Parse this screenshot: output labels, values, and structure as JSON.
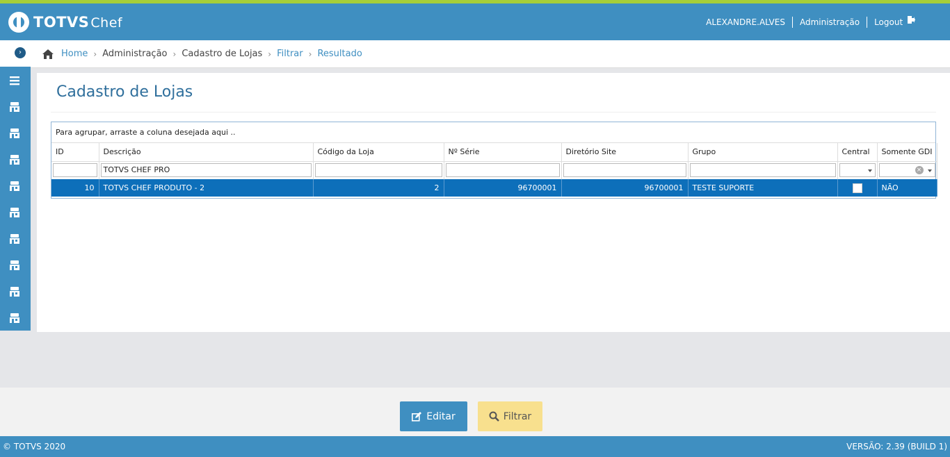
{
  "app": {
    "brand": "TOTVS",
    "brand_sub": "Chef"
  },
  "header": {
    "user": "ALEXANDRE.ALVES",
    "admin_link": "Administração",
    "logout": "Logout"
  },
  "breadcrumb": {
    "home": "Home",
    "items": [
      "Administração",
      "Cadastro de Lojas",
      "Filtrar",
      "Resultado"
    ]
  },
  "page": {
    "title": "Cadastro de Lojas"
  },
  "grid": {
    "group_hint": "Para agrupar, arraste a coluna desejada aqui ..",
    "columns": [
      "ID",
      "Descrição",
      "Código da Loja",
      "Nº Série",
      "Diretório Site",
      "Grupo",
      "Central",
      "Somente GDI"
    ],
    "filters": {
      "descricao": "TOTVS CHEF PRO"
    },
    "rows": [
      {
        "id": "10",
        "descricao": "TOTVS CHEF PRODUTO - 2",
        "codigo": "2",
        "serie": "96700001",
        "diretorio": "96700001",
        "grupo": "TESTE SUPORTE",
        "central": false,
        "somente_gdi": "NÃO"
      }
    ]
  },
  "buttons": {
    "edit": "Editar",
    "filter": "Filtrar"
  },
  "status": {
    "copyright": "© TOTVS 2020",
    "version": "VERSÃO: 2.39 (BUILD 1)"
  },
  "colors": {
    "primary": "#3f8fc1",
    "accent_stripe": "#a6ce39",
    "selected_row": "#0d6fba",
    "filter_button": "#f8e08e"
  }
}
